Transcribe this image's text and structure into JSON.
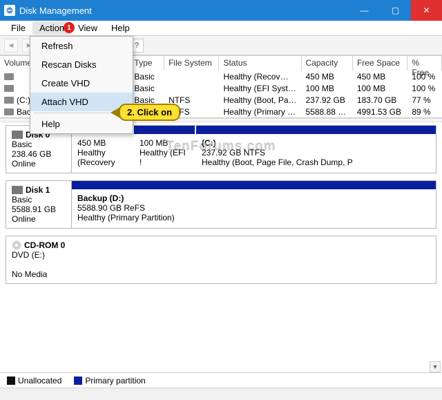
{
  "title": "Disk Management",
  "watermark": "TenForums.com",
  "menubar": [
    "File",
    "Action",
    "View",
    "Help"
  ],
  "action_menu": {
    "items": [
      "Refresh",
      "Rescan Disks",
      "Create VHD",
      "Attach VHD",
      "Help"
    ],
    "highlight_index": 3
  },
  "annotations": {
    "badge1": "1",
    "callout": "2. Click on"
  },
  "vol_columns": {
    "volume": "Volume",
    "type": "Type",
    "fs": "File System",
    "status": "Status",
    "cap": "Capacity",
    "free": "Free Space",
    "pct": "% Free"
  },
  "volumes": [
    {
      "volume": "",
      "type": "Basic",
      "fs": "",
      "status": "Healthy (Recov…",
      "cap": "450 MB",
      "free": "450 MB",
      "pct": "100 %"
    },
    {
      "volume": "",
      "type": "Basic",
      "fs": "",
      "status": "Healthy (EFI Syst…",
      "cap": "100 MB",
      "free": "100 MB",
      "pct": "100 %"
    },
    {
      "volume": "(C:)",
      "type": "Basic",
      "fs": "NTFS",
      "status": "Healthy (Boot, Pa…",
      "cap": "237.92 GB",
      "free": "183.70 GB",
      "pct": "77 %"
    },
    {
      "volume": "Backup (D:)",
      "type": "Basic",
      "fs": "ReFS",
      "status": "Healthy (Primary …",
      "cap": "5588.88 GB",
      "free": "4991.53 GB",
      "pct": "89 %"
    }
  ],
  "disks": [
    {
      "name": "Disk 0",
      "kind": "Basic",
      "size": "238.46 GB",
      "state": "Online",
      "parts": [
        {
          "w": "pw-a",
          "l1": "",
          "l2": "450 MB",
          "l3": "Healthy (Recovery"
        },
        {
          "w": "pw-b",
          "l1": "",
          "l2": "100 MB",
          "l3": "Healthy (EFI !"
        },
        {
          "w": "pw-c",
          "l1": "(C:)",
          "l2": "237.92 GB NTFS",
          "l3": "Healthy (Boot, Page File, Crash Dump, P"
        }
      ]
    },
    {
      "name": "Disk 1",
      "kind": "Basic",
      "size": "5588.91 GB",
      "state": "Online",
      "parts": [
        {
          "w": "pw-c",
          "l1": "Backup  (D:)",
          "l2": "5588.90 GB ReFS",
          "l3": "Healthy (Primary Partition)"
        }
      ]
    }
  ],
  "cdrom": {
    "name": "CD-ROM 0",
    "kind": "DVD (E:)",
    "state": "No Media"
  },
  "legend": {
    "unalloc": "Unallocated",
    "primary": "Primary partition"
  }
}
